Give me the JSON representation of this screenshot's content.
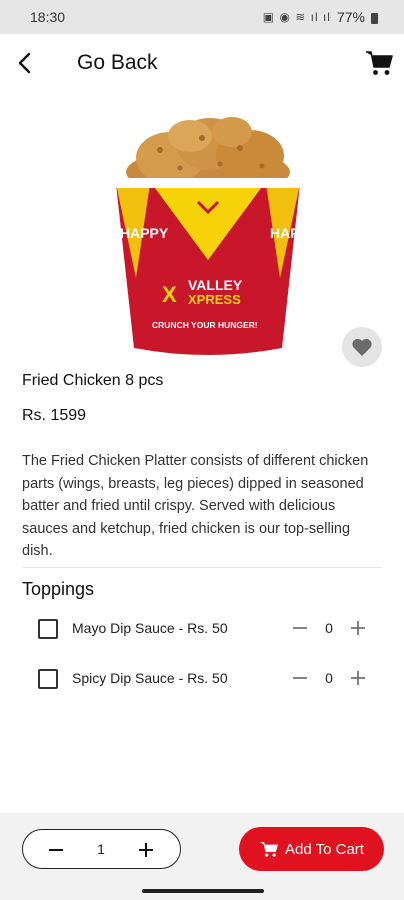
{
  "status_bar": {
    "time": "18:30",
    "battery": "77%"
  },
  "header": {
    "title": "Go Back"
  },
  "product": {
    "name": "Fried Chicken 8 pcs",
    "price": "Rs. 1599",
    "description": "The Fried Chicken Platter consists of different chicken parts (wings, breasts, leg pieces) dipped in seasoned batter and fried until crispy. Served with delicious sauces and ketchup, fried chicken is our top-selling dish.",
    "bucket_brand": "VALLEY",
    "bucket_brand_sub": "XPRESS",
    "bucket_slogan": "CRUNCH YOUR HUNGER!",
    "bucket_side_text": "HAPPY"
  },
  "toppings": {
    "title": "Toppings",
    "items": [
      {
        "label": "Mayo Dip Sauce - Rs. 50",
        "qty": "0"
      },
      {
        "label": "Spicy Dip Sauce - Rs. 50",
        "qty": "0"
      }
    ]
  },
  "footer": {
    "quantity": "1",
    "add_to_cart": "Add To Cart"
  },
  "colors": {
    "accent": "#e0121f",
    "bucket_red": "#c8162a",
    "bucket_yellow": "#f5d20a"
  }
}
